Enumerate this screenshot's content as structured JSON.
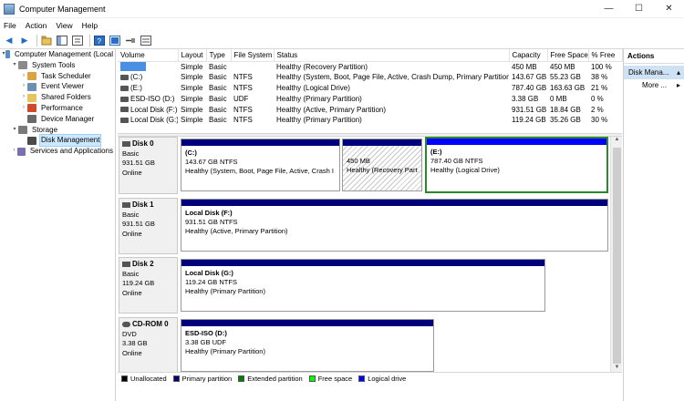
{
  "window": {
    "title": "Computer Management",
    "controls": {
      "minimize": "—",
      "maximize": "☐",
      "close": "✕"
    }
  },
  "menu": [
    "File",
    "Action",
    "View",
    "Help"
  ],
  "tree": [
    {
      "label": "Computer Management (Local",
      "indent": 0,
      "arrow": "▾",
      "icon": "computer-icon"
    },
    {
      "label": "System Tools",
      "indent": 1,
      "arrow": "▾",
      "icon": "tools-icon"
    },
    {
      "label": "Task Scheduler",
      "indent": 2,
      "arrow": "›",
      "icon": "clock-icon"
    },
    {
      "label": "Event Viewer",
      "indent": 2,
      "arrow": "›",
      "icon": "event-icon"
    },
    {
      "label": "Shared Folders",
      "indent": 2,
      "arrow": "›",
      "icon": "folder-icon"
    },
    {
      "label": "Performance",
      "indent": 2,
      "arrow": "›",
      "icon": "performance-icon"
    },
    {
      "label": "Device Manager",
      "indent": 2,
      "arrow": "",
      "icon": "device-icon"
    },
    {
      "label": "Storage",
      "indent": 1,
      "arrow": "▾",
      "icon": "storage-icon"
    },
    {
      "label": "Disk Management",
      "indent": 2,
      "arrow": "",
      "icon": "disk-icon",
      "selected": true
    },
    {
      "label": "Services and Applications",
      "indent": 1,
      "arrow": "›",
      "icon": "services-icon"
    }
  ],
  "volume_table": {
    "columns": [
      "Volume",
      "Layout",
      "Type",
      "File System",
      "Status",
      "Capacity",
      "Free Space",
      "% Free"
    ],
    "rows": [
      {
        "volume": "",
        "layout": "Simple",
        "type": "Basic",
        "fs": "",
        "status": "Healthy (Recovery Partition)",
        "capacity": "450 MB",
        "free": "450 MB",
        "pct": "100 %",
        "selected_volume": true
      },
      {
        "volume": "(C:)",
        "layout": "Simple",
        "type": "Basic",
        "fs": "NTFS",
        "status": "Healthy (System, Boot, Page File, Active, Crash Dump, Primary Partition)",
        "capacity": "143.67 GB",
        "free": "55.23 GB",
        "pct": "38 %"
      },
      {
        "volume": "(E:)",
        "layout": "Simple",
        "type": "Basic",
        "fs": "NTFS",
        "status": "Healthy (Logical Drive)",
        "capacity": "787.40 GB",
        "free": "163.63 GB",
        "pct": "21 %"
      },
      {
        "volume": "ESD-ISO (D:)",
        "layout": "Simple",
        "type": "Basic",
        "fs": "UDF",
        "status": "Healthy (Primary Partition)",
        "capacity": "3.38 GB",
        "free": "0 MB",
        "pct": "0 %"
      },
      {
        "volume": "Local Disk (F:)",
        "layout": "Simple",
        "type": "Basic",
        "fs": "NTFS",
        "status": "Healthy (Active, Primary Partition)",
        "capacity": "931.51 GB",
        "free": "18.84 GB",
        "pct": "2 %"
      },
      {
        "volume": "Local Disk (G:)",
        "layout": "Simple",
        "type": "Basic",
        "fs": "NTFS",
        "status": "Healthy (Primary Partition)",
        "capacity": "119.24 GB",
        "free": "35.26 GB",
        "pct": "30 %"
      }
    ]
  },
  "disks": [
    {
      "name": "Disk 0",
      "kind": "Basic",
      "size": "931.51 GB",
      "state": "Online",
      "partitions": [
        {
          "name": "(C:)",
          "size": "143.67 GB NTFS",
          "status": "Healthy (System, Boot, Page File, Active, Crash I"
        },
        {
          "name": "",
          "size": "450 MB",
          "status": "Healthy (Recovery Part"
        },
        {
          "name": "(E:)",
          "size": "787.40 GB NTFS",
          "status": "Healthy (Logical Drive)"
        }
      ]
    },
    {
      "name": "Disk 1",
      "kind": "Basic",
      "size": "931.51 GB",
      "state": "Online",
      "partitions": [
        {
          "name": "Local Disk  (F:)",
          "size": "931.51 GB NTFS",
          "status": "Healthy (Active, Primary Partition)"
        }
      ]
    },
    {
      "name": "Disk 2",
      "kind": "Basic",
      "size": "119.24 GB",
      "state": "Online",
      "partitions": [
        {
          "name": "Local Disk  (G:)",
          "size": "119.24 GB NTFS",
          "status": "Healthy (Primary Partition)"
        }
      ]
    },
    {
      "name": "CD-ROM 0",
      "kind": "DVD",
      "size": "3.38 GB",
      "state": "Online",
      "partitions": [
        {
          "name": "ESD-ISO  (D:)",
          "size": "3.38 GB UDF",
          "status": "Healthy (Primary Partition)"
        }
      ]
    }
  ],
  "legend": [
    {
      "label": "Unallocated",
      "color": "#000000"
    },
    {
      "label": "Primary partition",
      "color": "#00007d"
    },
    {
      "label": "Extended partition",
      "color": "#008000"
    },
    {
      "label": "Free space",
      "color": "#00ff00"
    },
    {
      "label": "Logical drive",
      "color": "#0000ff"
    }
  ],
  "actions": {
    "header": "Actions",
    "section": "Disk Mana...",
    "items": [
      "More ..."
    ]
  }
}
